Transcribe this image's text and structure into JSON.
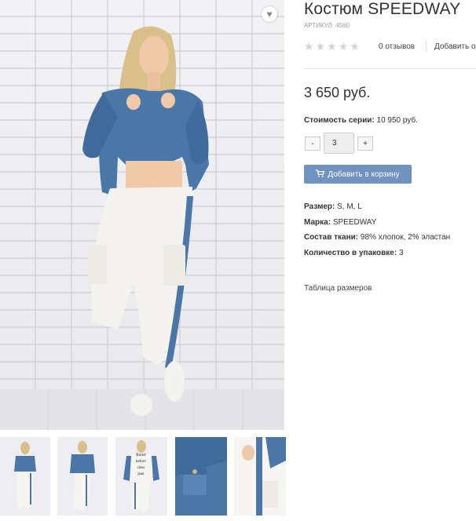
{
  "product": {
    "title": "Костюм SPEEDWAY",
    "sku": "АРТИКУЛ: 4560",
    "rating": 0,
    "reviews_label": "0 отзывов",
    "add_review_label": "Добавить о",
    "price": "3 650 руб.",
    "series_label": "Стоимость серии:",
    "series_value": "10 950 руб.",
    "quantity": "3",
    "minus_label": "-",
    "plus_label": "+",
    "add_to_cart_label": "Добавить в корзину",
    "properties": [
      {
        "label": "Размер:",
        "value": "S, M, L"
      },
      {
        "label": "Марка:",
        "value": "SPEEDWAY"
      },
      {
        "label": "Состав ткани:",
        "value": "98% хлопок, 2% эластан"
      },
      {
        "label": "Количество в упаковке:",
        "value": "3"
      }
    ],
    "size_table_label": "Таблица размеров"
  },
  "thumbnails": [
    {
      "icon": "model-front-photo"
    },
    {
      "icon": "model-front-photo-2"
    },
    {
      "icon": "model-back-photo",
      "print_text": "Bored\nbefore\nclass\njean"
    },
    {
      "icon": "jacket-closeup-photo"
    },
    {
      "icon": "pants-closeup-photo"
    }
  ],
  "colors": {
    "accent": "#6f93c1",
    "denim": "#4a77a8",
    "white_garment": "#f4f3ef"
  }
}
